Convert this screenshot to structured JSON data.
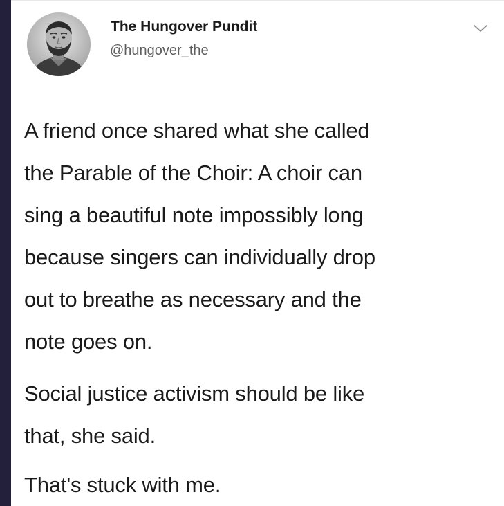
{
  "tweet": {
    "display_name": "The Hungover Pundit",
    "handle": "@hungover_the",
    "menu_icon": "chevron-down-icon",
    "paragraph_1_lines": [
      "A friend once shared what she called",
      "the Parable of the Choir: A choir can",
      "sing a beautiful note impossibly long",
      "because singers can individually drop",
      "out to breathe as necessary and the",
      "note goes on."
    ],
    "paragraph_2_lines": [
      "Social justice activism should be like",
      "that, she said."
    ],
    "paragraph_3_lines": [
      "That's stuck with me."
    ]
  },
  "colors": {
    "left_border": "#22203a",
    "text": "#1a1a1a",
    "handle": "#5f5f5f"
  }
}
